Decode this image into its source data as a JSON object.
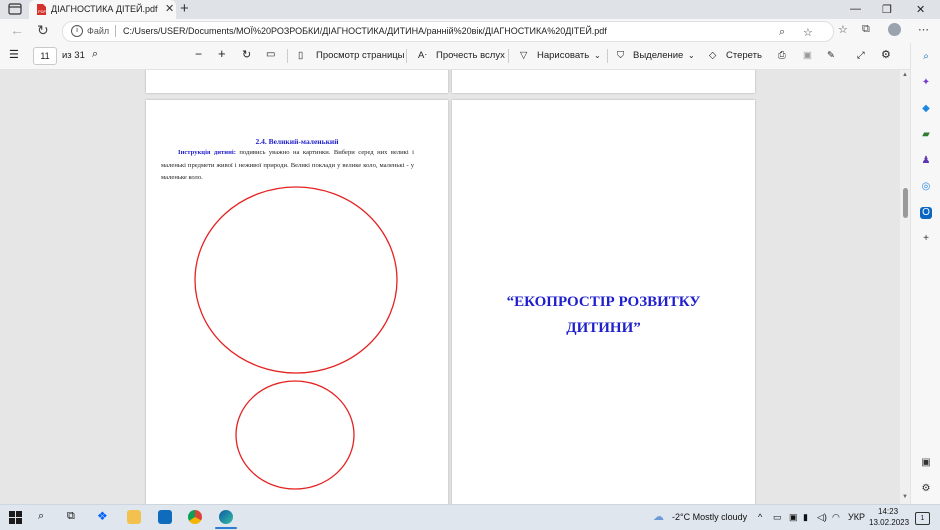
{
  "browser": {
    "tab_title": "ДІАГНОСТИКА ДІТЕЙ.pdf",
    "new_tab": "+",
    "close_tab": "✕",
    "address_label": "Файл",
    "url": "C:/Users/USER/Documents/МОЇ%20РОЗРОБКИ/ДІАГНОСТИКА/ДИТИНА/ранній%20вік/ДІАГНОСТИКА%20ДІТЕЙ.pdf"
  },
  "pdf_toolbar": {
    "page_number": "11",
    "page_total": "из 31",
    "page_view": "Просмотр страницы",
    "read_aloud": "Прочесть вслух",
    "draw": "Нарисовать",
    "highlight": "Выделение",
    "erase": "Стереть"
  },
  "document": {
    "left_page": {
      "heading": "2.4. Великий-маленький",
      "instruction_label": "Інструкція дитині:",
      "instruction_text": " подивись уважно на картинки. Вибери серед них великі і маленькі предмети живої і неживої природи. Великі поклади у велике коло, маленькі - у маленьке коло."
    },
    "right_page": {
      "title_line1": "“ЕКОПРОСТІР РОЗВИТКУ",
      "title_line2": "ДИТИНИ”"
    },
    "circle_color": "#e52222"
  },
  "taskbar": {
    "weather": "-2°C  Mostly cloudy",
    "language": "УКР",
    "time": "14:23",
    "date": "13.02.2023",
    "notifications": "1"
  },
  "colors": {
    "accent_blue": "#1f1fcc",
    "pdf_red": "#d6322b"
  }
}
